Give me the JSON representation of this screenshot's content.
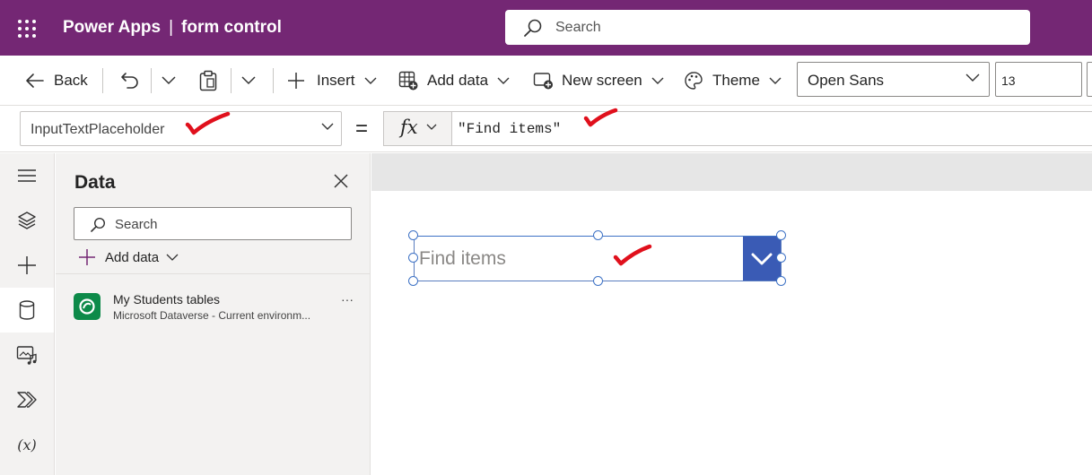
{
  "app": {
    "product": "Power Apps",
    "separator": "|",
    "app_name": "form control",
    "search_placeholder": "Search"
  },
  "toolbar": {
    "back": "Back",
    "insert": "Insert",
    "add_data": "Add data",
    "new_screen": "New screen",
    "theme": "Theme",
    "font": "Open Sans",
    "font_size": "13"
  },
  "formula": {
    "property": "InputTextPlaceholder",
    "equals": "=",
    "fx": "fx",
    "value": "\"Find items\""
  },
  "data_pane": {
    "title": "Data",
    "search_placeholder": "Search",
    "add_data": "Add data",
    "source": {
      "name": "My Students tables",
      "subtitle": "Microsoft Dataverse - Current environm...",
      "more": "···"
    }
  },
  "rail": {
    "variables_label": "(x)"
  },
  "canvas": {
    "combo_placeholder": "Find items"
  },
  "colors": {
    "brand": "#742774",
    "selection": "#3e72c5",
    "combo_button": "#3a5bb5",
    "annotation": "#e0101c",
    "dataverse": "#0d8a49"
  },
  "icons": [
    "waffle-icon",
    "search-icon",
    "back-arrow-icon",
    "undo-icon",
    "paste-icon",
    "plus-icon",
    "table-add-icon",
    "new-screen-icon",
    "palette-icon",
    "chevron-down-icon",
    "hamburger-icon",
    "layers-icon",
    "database-icon",
    "media-icon",
    "flow-icon",
    "close-icon",
    "dataverse-icon",
    "checkmark-annotation"
  ]
}
